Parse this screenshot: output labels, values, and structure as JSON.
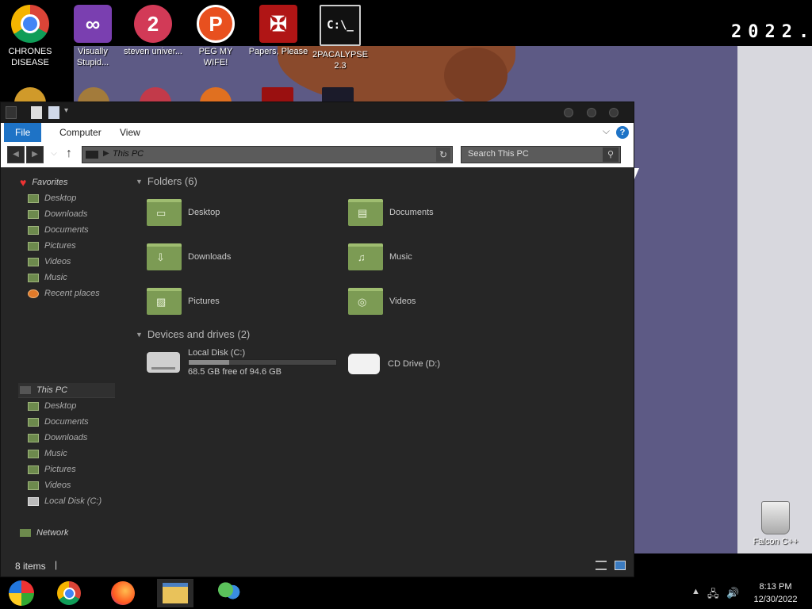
{
  "desktop": {
    "year_text": "2022.",
    "icons": [
      {
        "label": "CHRONES DISEASE",
        "icon": "chrome-icon"
      },
      {
        "label": "Visually Stupid...",
        "icon": "visual-studio-icon"
      },
      {
        "label": "steven univer...",
        "icon": "steven-universe-icon"
      },
      {
        "label": "PEG MY WIFE!",
        "icon": "p-logo-icon"
      },
      {
        "label": "Papers, Please",
        "icon": "papers-please-icon"
      },
      {
        "label": "2PACALYPSE 2.3",
        "icon": "command-prompt-icon"
      }
    ],
    "recycle_bin_label": "Falcon C++"
  },
  "explorer": {
    "ribbon_tabs": [
      "File",
      "Computer",
      "View"
    ],
    "address": "This PC",
    "search_placeholder": "Search This PC",
    "nav": {
      "favorites_label": "Favorites",
      "favorites": [
        "Desktop",
        "Downloads",
        "Documents",
        "Pictures",
        "Videos",
        "Music",
        "Recent places"
      ],
      "thispc_label": "This PC",
      "thispc": [
        "Desktop",
        "Documents",
        "Downloads",
        "Music",
        "Pictures",
        "Videos",
        "Local Disk (C:)"
      ],
      "network_label": "Network"
    },
    "folders_header": "Folders (6)",
    "folders": [
      "Desktop",
      "Documents",
      "Downloads",
      "Music",
      "Pictures",
      "Videos"
    ],
    "devices_header": "Devices and drives (2)",
    "drives": [
      {
        "name": "Local Disk (C:)",
        "free_text": "68.5 GB free of 94.6 GB",
        "used_fraction": 0.276
      },
      {
        "name": "CD Drive (D:)"
      }
    ],
    "status_count": "8 items"
  },
  "taskbar": {
    "apps": [
      "start-orb-icon",
      "chrome-icon",
      "firefox-icon",
      "file-explorer-icon",
      "messenger-icon"
    ],
    "time": "8:13 PM",
    "date": "12/30/2022"
  }
}
